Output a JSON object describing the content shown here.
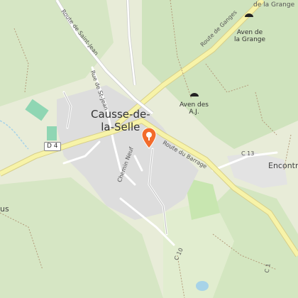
{
  "map": {
    "places": [
      {
        "name_line1": "Causse-de-",
        "name_line2": "la-Selle"
      },
      {
        "name_line1": "Aven de",
        "name_line2": "la Grange"
      },
      {
        "name_line1": "Aven des",
        "name_line2": "A.J."
      }
    ],
    "partial_labels": {
      "top_right": "de la Grange",
      "right": "Encontre",
      "left": "us"
    },
    "roads": {
      "route_de_ganges": "Route de Ganges",
      "route_de_saint_jean": "Route de Saint-Jean",
      "rue_de_st_jean": "Rue de St-Jean",
      "route_du_barrage": "Route du Barrage",
      "chemin_neuf": "Chemin Neuf",
      "d4": "D 4",
      "c13": "C 13",
      "c10": "C 10",
      "c1": "C 1"
    },
    "marker": {
      "icon": "location-pin-icon",
      "color": "#f26b2b"
    },
    "colors": {
      "land": "#e8ecd8",
      "wood": "#cfe3bd",
      "urban": "#dddddd",
      "road": "#f7f3a8",
      "water": "#a7d3e8"
    }
  }
}
